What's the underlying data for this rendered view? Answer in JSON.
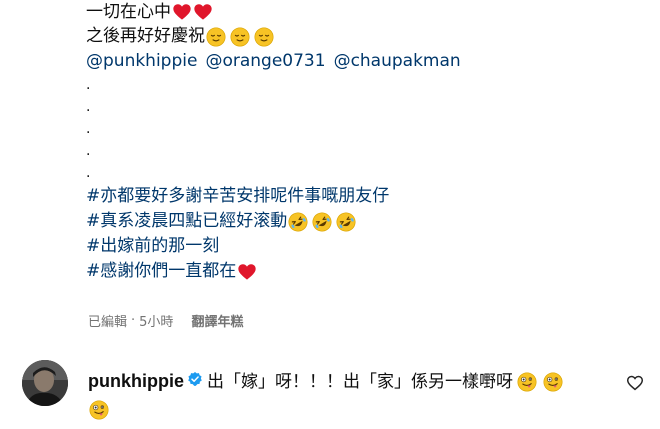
{
  "caption": {
    "line1_text": "一切在心中",
    "line2_text": "之後再好好慶祝",
    "mentions": [
      "@punkhippie",
      "@orange0731",
      "@chaupakman"
    ],
    "dots": [
      ".",
      ".",
      ".",
      ".",
      "."
    ],
    "hashtag1": "#亦都要好多謝辛苦安排呢件事嘅朋友仔",
    "hashtag2": "#真系凌晨四點已經好滚動",
    "hashtag3": "#出嫁前的那一刻",
    "hashtag4": "#感謝你們一直都在"
  },
  "meta": {
    "edited": "已編輯",
    "separator": "·",
    "time": "5小時",
    "translate": "翻譯年糕"
  },
  "comment": {
    "username": "punkhippie",
    "text": "出「嫁」呀！！！出「家」係另一樣嘢呀"
  },
  "colors": {
    "link": "#00376b",
    "heart": "#e0162b",
    "emoji": "#f7c325",
    "verified": "#1d9bf0",
    "meta": "#737373"
  },
  "icons": {
    "heart": "heart-emoji",
    "relieved": "relieved-face-emoji",
    "laughing": "rolling-laughing-emoji",
    "zany": "zany-face-emoji",
    "verified": "verified-badge-icon",
    "like": "heart-outline-icon"
  }
}
